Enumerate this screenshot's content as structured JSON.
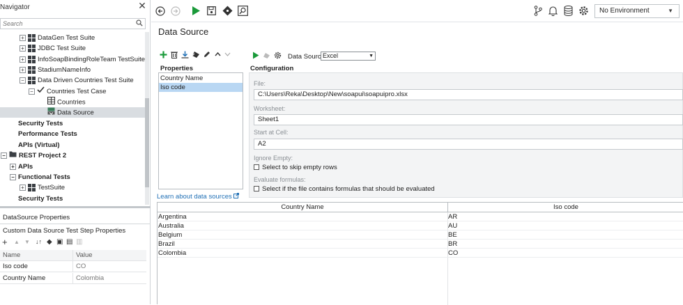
{
  "navigator": {
    "title": "Navigator",
    "search_placeholder": "Search",
    "tree": [
      {
        "label": "DataGen Test Suite"
      },
      {
        "label": "JDBC Test Suite"
      },
      {
        "label": "InfoSoapBindingRoleTeam TestSuite"
      },
      {
        "label": "StadiumNameInfo"
      },
      {
        "label": "Data Driven Countries Test Suite"
      },
      {
        "label": "Countries Test Case"
      },
      {
        "label": "Countries"
      },
      {
        "label": "Data Source"
      },
      {
        "label": "Security Tests"
      },
      {
        "label": "Performance Tests"
      },
      {
        "label": "APIs (Virtual)"
      },
      {
        "label": "REST Project 2"
      },
      {
        "label": "APIs"
      },
      {
        "label": "Functional Tests"
      },
      {
        "label": "TestSuite"
      },
      {
        "label": "Security Tests"
      }
    ]
  },
  "bottom_panels": {
    "datasource_properties": "DataSource Properties",
    "custom_properties": "Custom Data Source Test Step Properties",
    "table_headers": [
      "Name",
      "Value"
    ],
    "rows": [
      {
        "name": "Iso code",
        "value": "CO"
      },
      {
        "name": "Country Name",
        "value": "Colombia"
      }
    ]
  },
  "environment": {
    "selected": "No Environment"
  },
  "page": {
    "title": "Data Source"
  },
  "properties": {
    "label": "Properties",
    "items": [
      "Country Name",
      "Iso code"
    ],
    "selected_index": 1,
    "learn_link": "Learn about data sources"
  },
  "config": {
    "label": "Configuration",
    "data_source_label": "Data Sourc...",
    "data_source_value": "Excel",
    "file_label": "File:",
    "file_value": "C:\\Users\\Reka\\Desktop\\New\\soapui\\soapuipro.xlsx",
    "worksheet_label": "Worksheet:",
    "worksheet_value": "Sheet1",
    "start_label": "Start at Cell:",
    "start_value": "A2",
    "ignore_empty_label": "Ignore Empty:",
    "ignore_empty_check": "Select to skip empty rows",
    "evaluate_label": "Evaluate formulas:",
    "evaluate_check": "Select if the file contains formulas that should be evaluated"
  },
  "data_table": {
    "headers": [
      "Country Name",
      "Iso code"
    ],
    "rows": [
      [
        "Argentina",
        "AR"
      ],
      [
        "Australia",
        "AU"
      ],
      [
        "Belgium",
        "BE"
      ],
      [
        "Brazil",
        "BR"
      ],
      [
        "Colombia",
        "CO"
      ]
    ]
  },
  "colors": {
    "accent_green": "#1a9a3a",
    "selection_blue": "#b9d7f3",
    "link_blue": "#1f6fb5"
  }
}
